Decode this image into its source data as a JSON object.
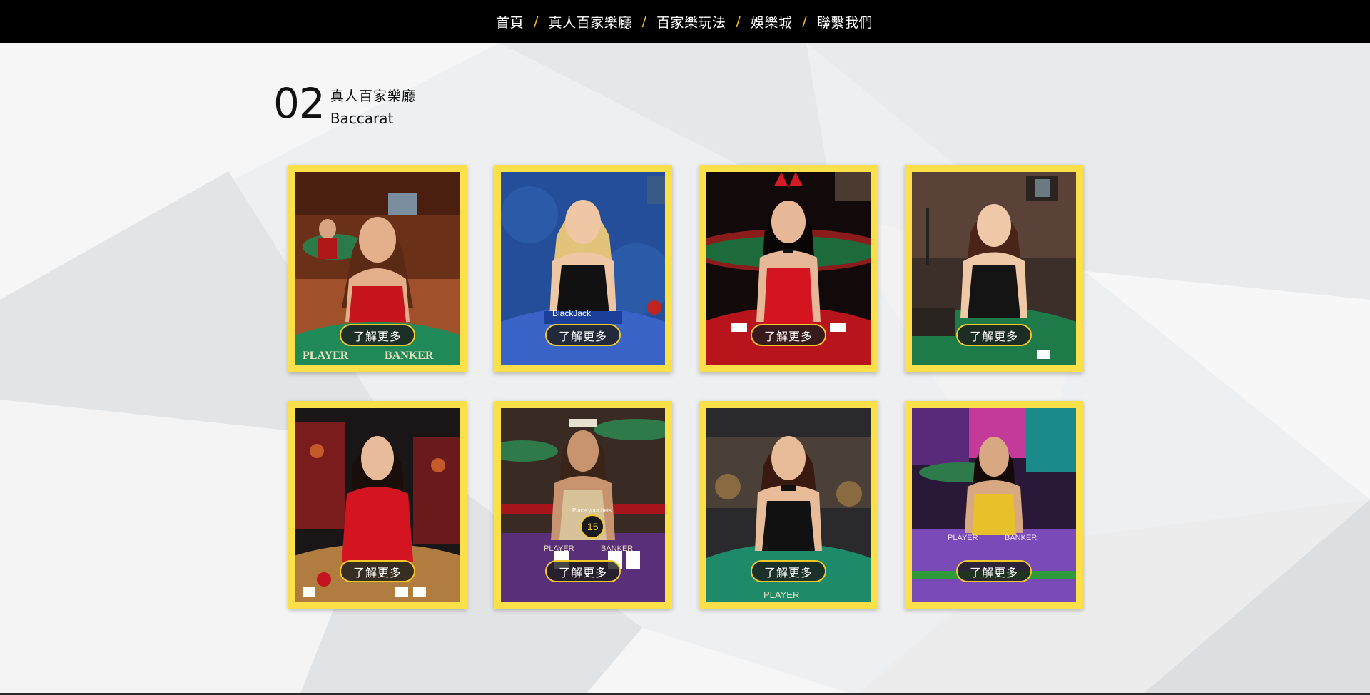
{
  "nav": {
    "items": [
      {
        "label": "首頁"
      },
      {
        "label": "真人百家樂廳"
      },
      {
        "label": "百家樂玩法"
      },
      {
        "label": "娛樂城"
      },
      {
        "label": "聯繫我們"
      }
    ],
    "separator": "/"
  },
  "section": {
    "number": "02",
    "title_cn": "真人百家樂廳",
    "title_en": "Baccarat"
  },
  "cards": [
    {
      "button": "了解更多",
      "table_text": [
        "PLAYER",
        "BANKER"
      ]
    },
    {
      "button": "了解更多",
      "table_text": [
        "BlackJack"
      ]
    },
    {
      "button": "了解更多",
      "table_text": []
    },
    {
      "button": "了解更多",
      "table_text": []
    },
    {
      "button": "了解更多",
      "table_text": []
    },
    {
      "button": "了解更多",
      "table_text": [
        "Place your bets",
        "15",
        "PLAYER",
        "BANKER"
      ]
    },
    {
      "button": "了解更多",
      "table_text": [
        "PLAYER"
      ]
    },
    {
      "button": "了解更多",
      "table_text": [
        "PLAYER",
        "BANKER"
      ]
    }
  ],
  "colors": {
    "nav_bg": "#000000",
    "accent": "#f5c518",
    "card_frame": "#fbe04a",
    "page_bg": "#eeeff0"
  }
}
